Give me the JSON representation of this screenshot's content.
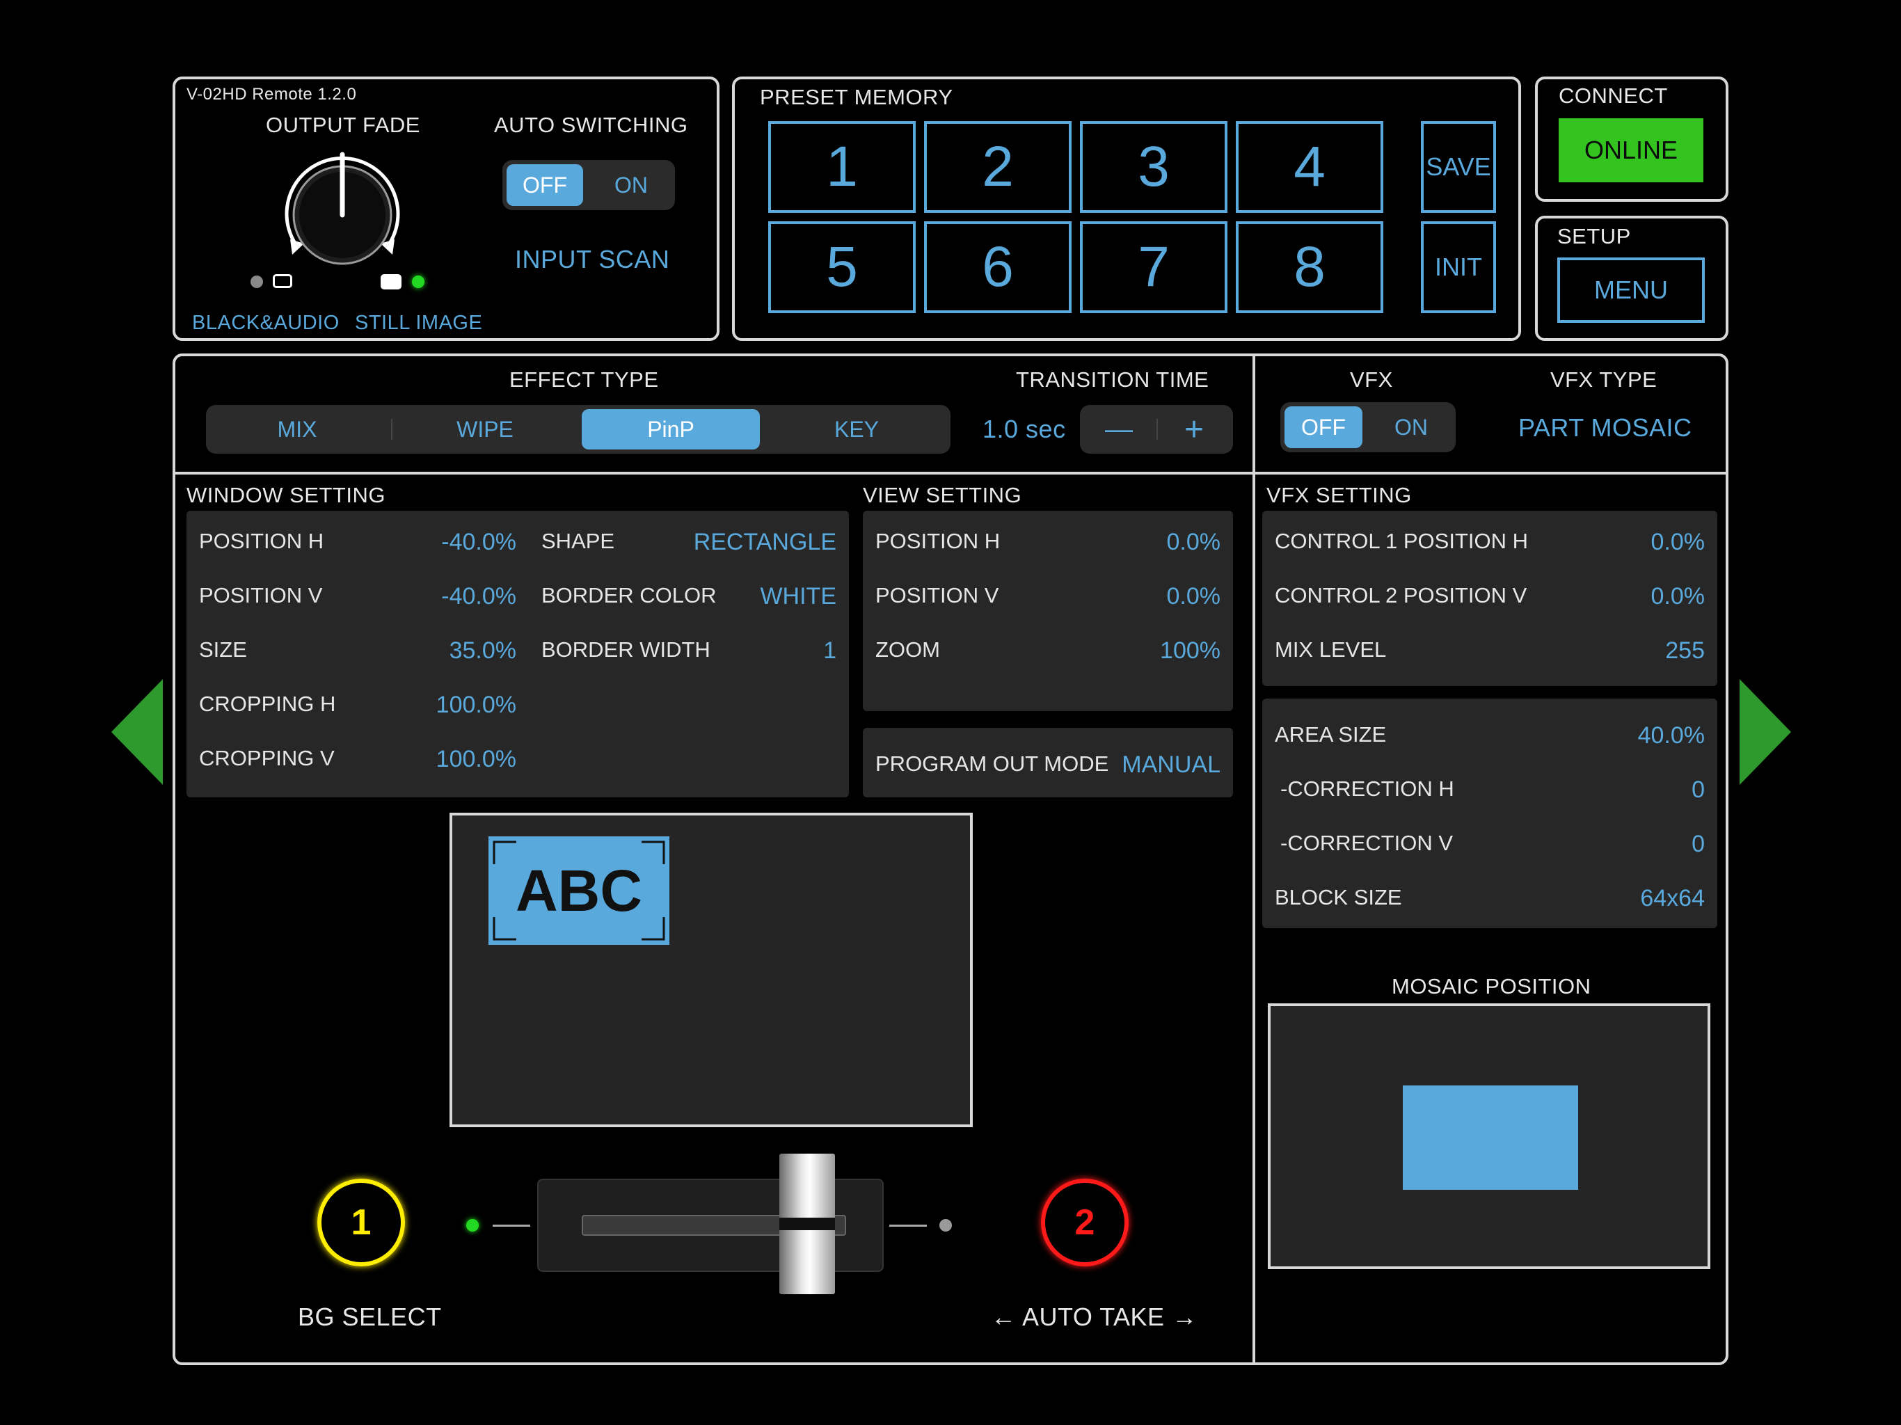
{
  "app": {
    "version": "V-02HD Remote 1.2.0"
  },
  "output_fade": {
    "title": "OUTPUT FADE",
    "left_label": "BLACK&AUDIO",
    "right_label": "STILL IMAGE"
  },
  "auto_switching": {
    "title": "AUTO SWITCHING",
    "off": "OFF",
    "on": "ON",
    "selected": "OFF",
    "input_scan": "INPUT SCAN"
  },
  "preset_memory": {
    "title": "PRESET MEMORY",
    "buttons": [
      "1",
      "2",
      "3",
      "4",
      "5",
      "6",
      "7",
      "8"
    ],
    "save": "SAVE",
    "init": "INIT"
  },
  "connect": {
    "title": "CONNECT",
    "status": "ONLINE"
  },
  "setup": {
    "title": "SETUP",
    "menu": "MENU"
  },
  "effect_type": {
    "title": "EFFECT TYPE",
    "options": [
      "MIX",
      "WIPE",
      "PinP",
      "KEY"
    ],
    "selected": "PinP"
  },
  "transition_time": {
    "title": "TRANSITION TIME",
    "value": "1.0 sec",
    "minus": "—",
    "plus": "+"
  },
  "vfx": {
    "title": "VFX",
    "off": "OFF",
    "on": "ON",
    "selected": "OFF"
  },
  "vfx_type": {
    "title": "VFX TYPE",
    "value": "PART MOSAIC"
  },
  "window_setting": {
    "title": "WINDOW SETTING",
    "left": [
      {
        "label": "POSITION H",
        "value": "-40.0%"
      },
      {
        "label": "POSITION V",
        "value": "-40.0%"
      },
      {
        "label": "SIZE",
        "value": "35.0%"
      },
      {
        "label": "CROPPING H",
        "value": "100.0%"
      },
      {
        "label": "CROPPING V",
        "value": "100.0%"
      }
    ],
    "right": [
      {
        "label": "SHAPE",
        "value": "RECTANGLE"
      },
      {
        "label": "BORDER COLOR",
        "value": "WHITE"
      },
      {
        "label": "BORDER WIDTH",
        "value": "1"
      }
    ]
  },
  "view_setting": {
    "title": "VIEW SETTING",
    "rows": [
      {
        "label": "POSITION H",
        "value": "0.0%"
      },
      {
        "label": "POSITION V",
        "value": "0.0%"
      },
      {
        "label": "ZOOM",
        "value": "100%"
      }
    ],
    "program_out_mode": {
      "label": "PROGRAM OUT MODE",
      "value": "MANUAL"
    }
  },
  "vfx_setting": {
    "title": "VFX SETTING",
    "rows_a": [
      {
        "label": "CONTROL 1 POSITION H",
        "value": "0.0%"
      },
      {
        "label": "CONTROL 2 POSITION V",
        "value": "0.0%"
      },
      {
        "label": "MIX LEVEL",
        "value": "255"
      }
    ],
    "rows_b": [
      {
        "label": "AREA SIZE",
        "value": "40.0%"
      },
      {
        "label": "-CORRECTION H",
        "value": "0"
      },
      {
        "label": "-CORRECTION V",
        "value": "0"
      },
      {
        "label": "BLOCK SIZE",
        "value": "64x64"
      }
    ]
  },
  "preview": {
    "inset_text": "ABC"
  },
  "bus": {
    "a_number": "1",
    "a_label": "BG SELECT",
    "b_number": "2",
    "b_label": "← AUTO TAKE →",
    "fader_position": 0.82
  },
  "mosaic_position": {
    "title": "MOSAIC POSITION"
  },
  "colors": {
    "accent": "#5aa9dc",
    "online": "#33c420",
    "arrow": "#2e9a2e",
    "bus_a": "#ffee00",
    "bus_b": "#ff1a1a"
  }
}
